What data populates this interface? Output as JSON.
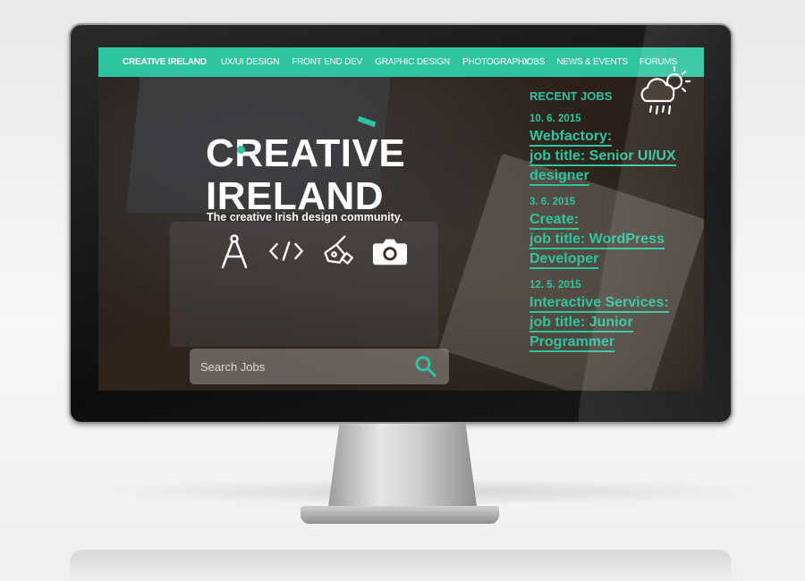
{
  "nav": {
    "brand": "CREATIVE IRELAND",
    "links_left": [
      "UX/UI DESIGN",
      "FRONT END DEV",
      "GRAPHIC DESIGN",
      "PHOTOGRAPHY"
    ],
    "links_right": [
      "JOBS",
      "NEWS & EVENTS",
      "FORUMS"
    ]
  },
  "hero": {
    "logo_line1": "CREATIVE",
    "logo_line2": "IRELAND",
    "tagline": "The creative Irish design community.",
    "icons": [
      "compass-icon",
      "code-icon",
      "pen-tool-icon",
      "camera-icon"
    ]
  },
  "search": {
    "placeholder": "Search Jobs",
    "button_icon": "search-icon"
  },
  "jobs": {
    "title": "RECENT JOBS",
    "items": [
      {
        "date": "10. 6. 2015",
        "lines": [
          "Webfactory:",
          "job title: Senior UI/UX",
          "designer"
        ]
      },
      {
        "date": "3. 6. 2015",
        "lines": [
          "Create:",
          "job title: WordPress",
          "Developer"
        ]
      },
      {
        "date": "12. 5. 2015",
        "lines": [
          "Interactive Services:",
          "job title: Junior",
          "Programmer"
        ]
      }
    ]
  },
  "weather": {
    "icon": "cloud-sun-rain-icon"
  },
  "colors": {
    "accent": "#2ec4a0",
    "text": "#ffffff"
  }
}
